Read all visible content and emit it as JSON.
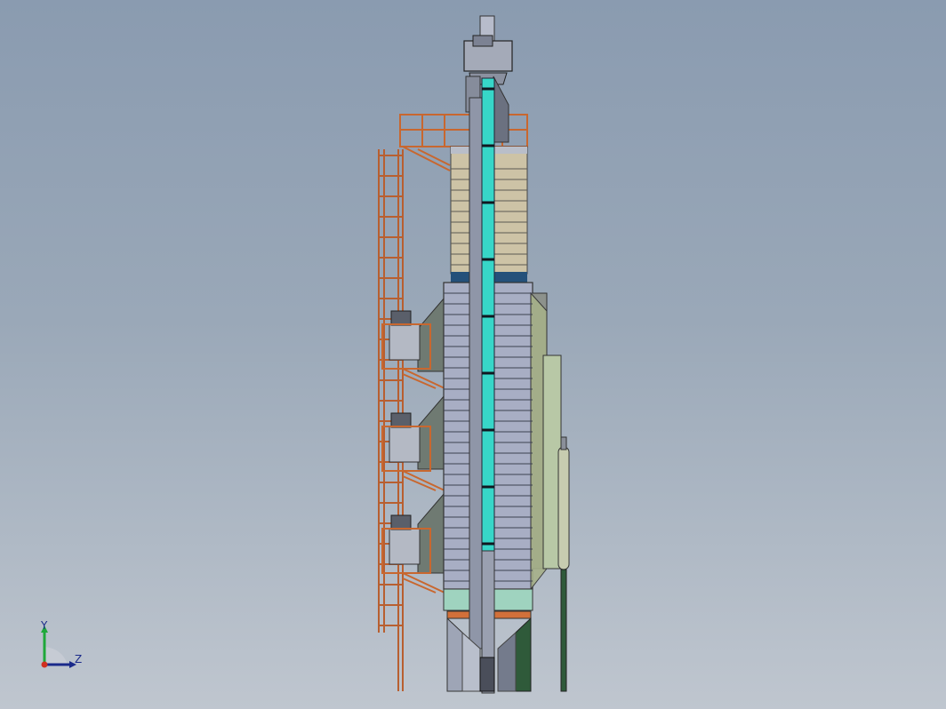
{
  "viewport": {
    "background_top": "#8a9bb0",
    "background_bottom": "#bfc6cf"
  },
  "model": {
    "description_icon": "grain-dryer-tower-icon",
    "colors": {
      "steel": "#a7adbb",
      "steel_dark": "#6f7585",
      "elevator_cyan": "#37d6c8",
      "railing_orange": "#d2703a",
      "tan_panels": "#cdc3a6",
      "green_panels": "#b8c8a6",
      "dark_green": "#2f5a3a",
      "navy_band": "#24507a"
    }
  },
  "triad": {
    "y_label": "Y",
    "z_label": "Z",
    "y_color": "#1fa83a",
    "z_color": "#1a2a8a",
    "origin_color": "#d03020"
  }
}
